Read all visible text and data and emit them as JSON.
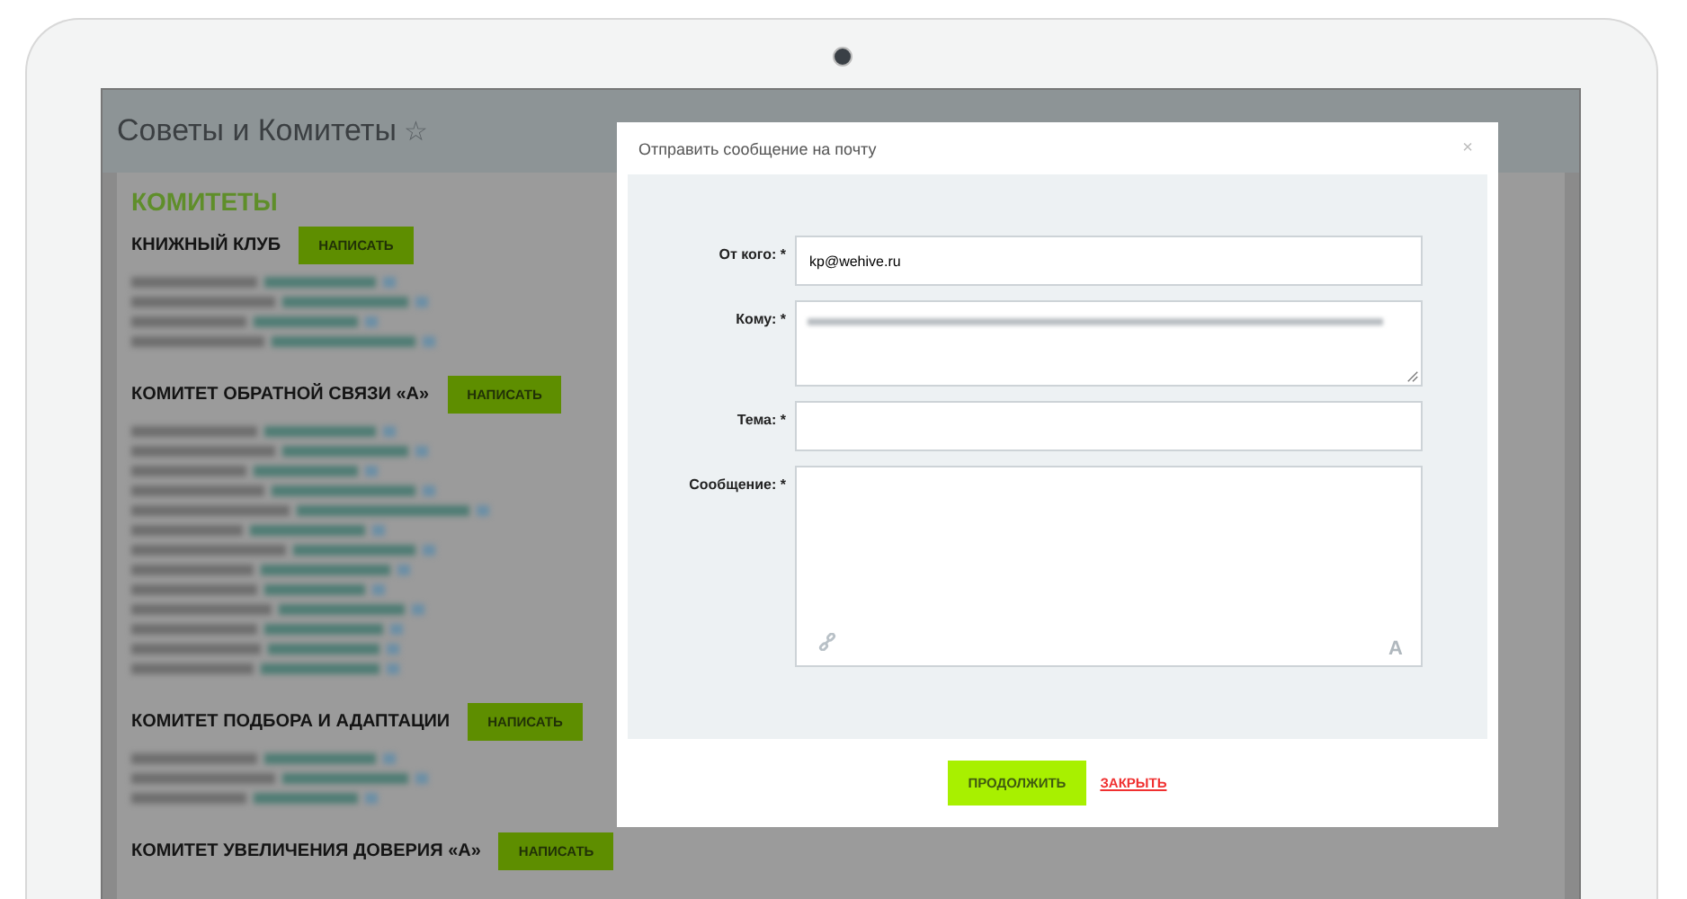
{
  "page": {
    "title": "Советы и Комитеты",
    "favorite_star": "☆",
    "section_heading": "КОМИТЕТЫ"
  },
  "committees": [
    {
      "name": "КНИЖНЫЙ КЛУБ",
      "button": "НАПИСАТЬ",
      "contacts": [
        {
          "kind": "blurred"
        },
        {
          "kind": "blurred"
        },
        {
          "kind": "blurred"
        },
        {
          "kind": "blurred"
        }
      ]
    },
    {
      "name": "КОМИТЕТ ОБРАТНОЙ СВЯЗИ «А»",
      "button": "НАПИСАТЬ",
      "contacts": [
        {
          "kind": "blurred"
        },
        {
          "kind": "blurred"
        },
        {
          "kind": "blurred"
        },
        {
          "kind": "blurred"
        },
        {
          "kind": "blurred"
        },
        {
          "kind": "blurred"
        },
        {
          "kind": "blurred"
        },
        {
          "kind": "blurred"
        },
        {
          "kind": "blurred"
        },
        {
          "kind": "blurred"
        },
        {
          "kind": "blurred"
        },
        {
          "kind": "blurred"
        },
        {
          "kind": "blurred"
        }
      ]
    },
    {
      "name": "КОМИТЕТ ПОДБОРА И АДАПТАЦИИ",
      "button": "НАПИСАТЬ",
      "contacts": [
        {
          "kind": "blurred"
        },
        {
          "kind": "blurred"
        },
        {
          "kind": "blurred"
        }
      ]
    },
    {
      "name": "КОМИТЕТ УВЕЛИЧЕНИЯ ДОВЕРИЯ «А»",
      "button": "НАПИСАТЬ"
    }
  ],
  "modal": {
    "title": "Отправить сообщение на почту",
    "close": "×",
    "fields": [
      {
        "kind": "input",
        "label": "От кого: *",
        "value": "kp@wehive.ru"
      },
      {
        "kind": "textarea",
        "label": "Кому: *",
        "value_blurred": true
      },
      {
        "kind": "input",
        "label": "Тема: *"
      },
      {
        "kind": "editor",
        "label": "Сообщение: *",
        "format_button": "A"
      }
    ],
    "submit": "ПРОДОЛЖИТЬ",
    "cancel": "ЗАКРЫТЬ"
  }
}
